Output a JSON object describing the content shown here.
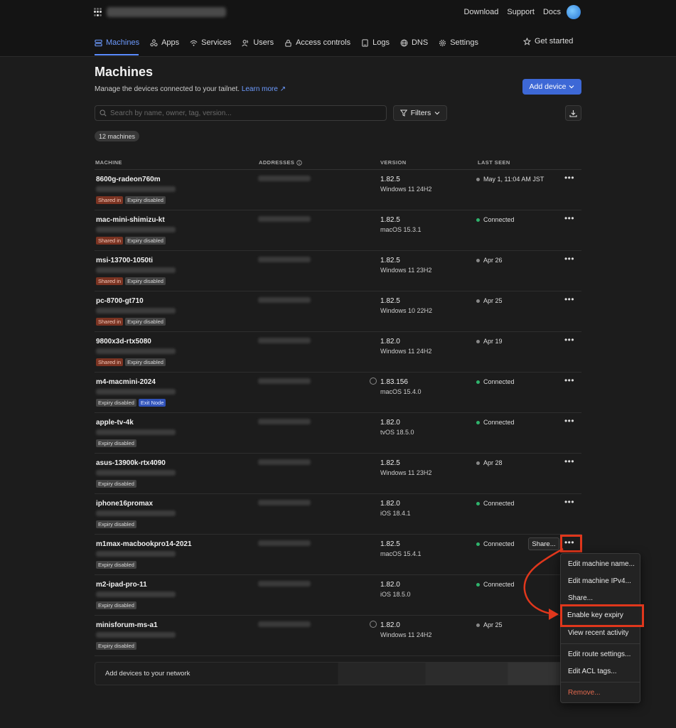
{
  "header": {
    "links": [
      "Download",
      "Support",
      "Docs"
    ]
  },
  "nav": {
    "items": [
      {
        "label": "Machines",
        "icon": "machines-icon",
        "active": true
      },
      {
        "label": "Apps",
        "icon": "apps-icon"
      },
      {
        "label": "Services",
        "icon": "services-icon"
      },
      {
        "label": "Users",
        "icon": "users-icon"
      },
      {
        "label": "Access controls",
        "icon": "lock-icon"
      },
      {
        "label": "Logs",
        "icon": "logs-icon"
      },
      {
        "label": "DNS",
        "icon": "globe-icon"
      },
      {
        "label": "Settings",
        "icon": "gear-icon"
      }
    ],
    "get_started": "Get started"
  },
  "page": {
    "title": "Machines",
    "subtitle": "Manage the devices connected to your tailnet.",
    "learn_more": "Learn more ↗",
    "add_device": "Add device",
    "search_placeholder": "Search by name, owner, tag, version...",
    "filters": "Filters",
    "count": "12 machines"
  },
  "columns": {
    "machine": "MACHINE",
    "addresses": "ADDRESSES",
    "version": "VERSION",
    "last_seen": "LAST SEEN"
  },
  "machines": [
    {
      "name": "8600g-radeon760m",
      "badges": [
        "Shared in",
        "Expiry disabled"
      ],
      "version": "1.82.5",
      "os": "Windows 11 24H2",
      "seen": "May 1, 11:04 AM JST",
      "connected": false
    },
    {
      "name": "mac-mini-shimizu-kt",
      "badges": [
        "Shared in",
        "Expiry disabled"
      ],
      "version": "1.82.5",
      "os": "macOS 15.3.1",
      "seen": "Connected",
      "connected": true
    },
    {
      "name": "msi-13700-1050ti",
      "badges": [
        "Shared in",
        "Expiry disabled"
      ],
      "version": "1.82.5",
      "os": "Windows 11 23H2",
      "seen": "Apr 26",
      "connected": false
    },
    {
      "name": "pc-8700-gt710",
      "badges": [
        "Shared in",
        "Expiry disabled"
      ],
      "version": "1.82.5",
      "os": "Windows 10 22H2",
      "seen": "Apr 25",
      "connected": false
    },
    {
      "name": "9800x3d-rtx5080",
      "badges": [
        "Shared in",
        "Expiry disabled"
      ],
      "version": "1.82.0",
      "os": "Windows 11 24H2",
      "seen": "Apr 19",
      "connected": false
    },
    {
      "name": "m4-macmini-2024",
      "badges": [
        "Expiry disabled",
        "Exit Node"
      ],
      "version": "1.83.156",
      "os": "macOS 15.4.0",
      "seen": "Connected",
      "connected": true,
      "update": true
    },
    {
      "name": "apple-tv-4k",
      "badges": [
        "Expiry disabled"
      ],
      "version": "1.82.0",
      "os": "tvOS 18.5.0",
      "seen": "Connected",
      "connected": true
    },
    {
      "name": "asus-13900k-rtx4090",
      "badges": [
        "Expiry disabled"
      ],
      "version": "1.82.5",
      "os": "Windows 11 23H2",
      "seen": "Apr 28",
      "connected": false
    },
    {
      "name": "iphone16promax",
      "badges": [
        "Expiry disabled"
      ],
      "version": "1.82.0",
      "os": "iOS 18.4.1",
      "seen": "Connected",
      "connected": true
    },
    {
      "name": "m1max-macbookpro14-2021",
      "badges": [
        "Expiry disabled"
      ],
      "version": "1.82.5",
      "os": "macOS 15.4.1",
      "seen": "Connected",
      "connected": true,
      "share": "Share...",
      "highlight": true
    },
    {
      "name": "m2-ipad-pro-11",
      "badges": [
        "Expiry disabled"
      ],
      "version": "1.82.0",
      "os": "iOS 18.5.0",
      "seen": "Connected",
      "connected": true
    },
    {
      "name": "minisforum-ms-a1",
      "badges": [
        "Expiry disabled"
      ],
      "version": "1.82.0",
      "os": "Windows 11 24H2",
      "seen": "Apr 25",
      "connected": false,
      "update": true
    }
  ],
  "footer": {
    "add_network": "Add devices to your network"
  },
  "context_menu": {
    "items": [
      "Edit machine name...",
      "Edit machine IPv4...",
      "Share...",
      "Enable key expiry",
      "View recent activity",
      "Edit route settings...",
      "Edit ACL tags...",
      "Remove..."
    ]
  },
  "colors": {
    "accent": "#3d68d6",
    "connected": "#2fb36c",
    "highlight": "#e0371c",
    "danger": "#e46a4e"
  }
}
